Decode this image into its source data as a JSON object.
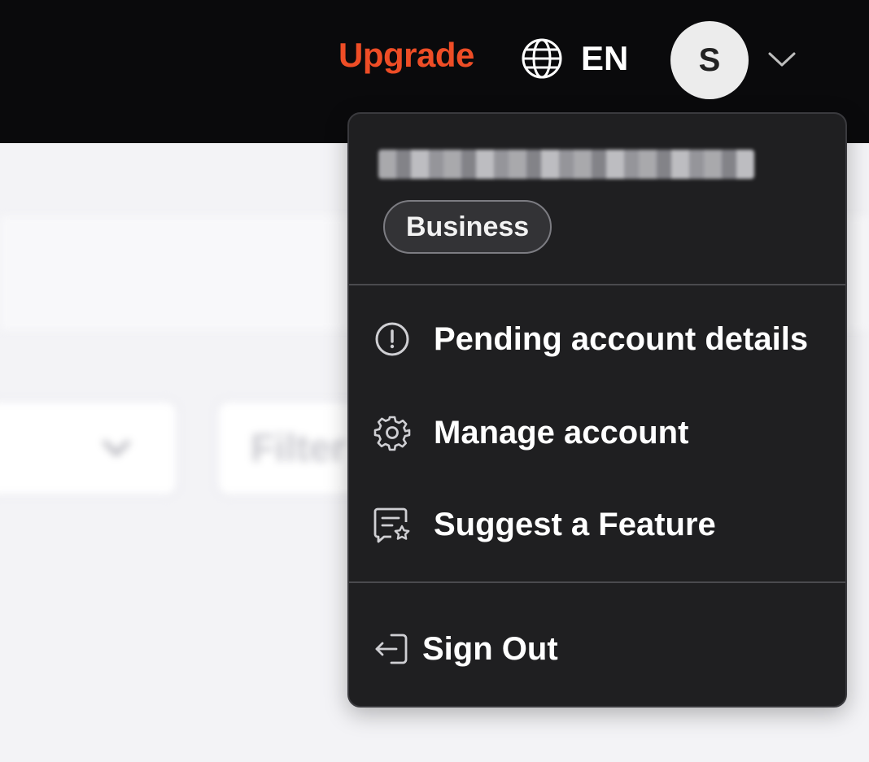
{
  "topbar": {
    "upgrade_label": "Upgrade",
    "language_label": "EN",
    "avatar_initial": "S",
    "accent_color": "#ee4d26"
  },
  "background": {
    "filter_label": "Filter"
  },
  "menu": {
    "plan_badge": "Business",
    "items": [
      {
        "label": "Pending account details",
        "icon": "alert-circle-icon"
      },
      {
        "label": "Manage account",
        "icon": "gear-icon"
      },
      {
        "label": "Suggest a Feature",
        "icon": "feedback-star-icon"
      }
    ],
    "sign_out": {
      "label": "Sign Out",
      "icon": "sign-out-icon"
    }
  }
}
